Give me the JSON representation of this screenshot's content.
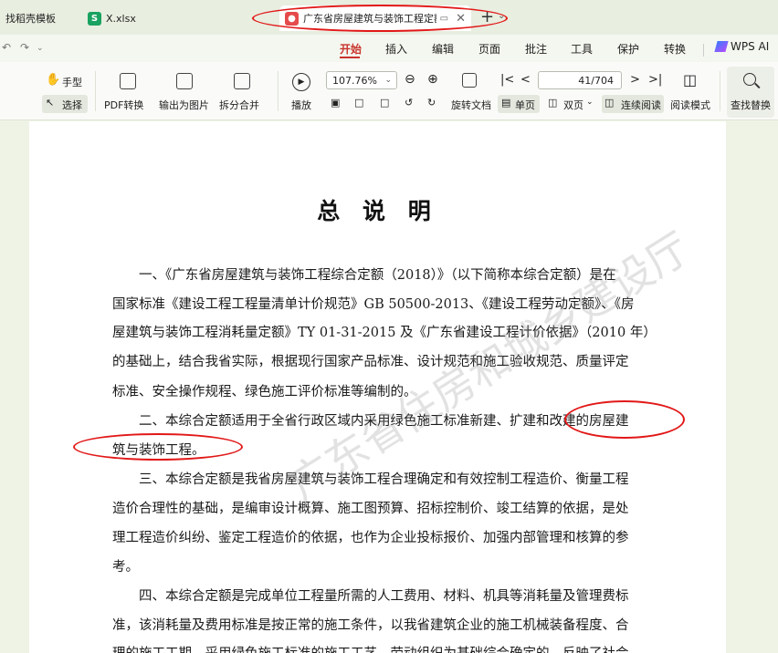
{
  "tabs": [
    {
      "label": "找稻壳模板",
      "badge": ""
    },
    {
      "label": "X.xlsx",
      "badge": "S"
    },
    {
      "label": "广东省房屋建筑与装饰工程定额",
      "badge": "P"
    }
  ],
  "menu": {
    "items": [
      "开始",
      "插入",
      "编辑",
      "页面",
      "批注",
      "工具",
      "保护",
      "转换"
    ],
    "ai_label": "WPS AI"
  },
  "toolbar": {
    "hand": "手型",
    "select": "选择",
    "pdf_convert": "PDF转换",
    "export_image": "输出为图片",
    "split_merge": "拆分合并",
    "play": "播放",
    "zoom": "107.76%",
    "rotate": "旋转文档",
    "page": "41/704",
    "single": "单页",
    "double": "双页",
    "continuous": "连续阅读",
    "reading": "阅读模式",
    "find_replace": "查找替换"
  },
  "document": {
    "title": "总 说 明",
    "lines": [
      "一、《广东省房屋建筑与装饰工程综合定额（2018）》（以下简称本综合定额）是在",
      "国家标准《建设工程工程量清单计价规范》GB 50500-2013、《建设工程劳动定额》、《房",
      "屋建筑与装饰工程消耗量定额》TY 01-31-2015 及《广东省建设工程计价依据》（2010 年）",
      "的基础上，结合我省实际，根据现行国家产品标准、设计规范和施工验收规范、质量评定",
      "标准、安全操作规程、绿色施工评价标准等编制的。",
      "二、本综合定额适用于全省行政区域内采用绿色施工标准新建、扩建和改建的房屋建",
      "筑与装饰工程。",
      "三、本综合定额是我省房屋建筑与装饰工程合理确定和有效控制工程造价、衡量工程",
      "造价合理性的基础，是编审设计概算、施工图预算、招标控制价、竣工结算的依据，是处",
      "理工程造价纠纷、鉴定工程造价的依据，也作为企业投标报价、加强内部管理和核算的参",
      "考。",
      "四、本综合定额是完成单位工程量所需的人工费用、材料、机具等消耗量及管理费标",
      "准，该消耗量及费用标准是按正常的施工条件，以我省建筑企业的施工机械装备程度、合",
      "理的施工工期、采用绿色施工标准的施工工艺、劳动组织为基础综合确定的，反映了社会"
    ],
    "watermark": "广东省住房和城乡建设厅"
  }
}
